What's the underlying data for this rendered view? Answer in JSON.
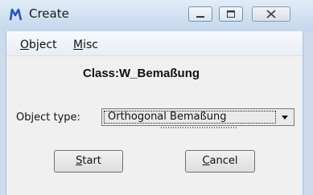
{
  "window": {
    "title": "Create",
    "icon": "mstn-logo-icon",
    "buttons": [
      "minimize-icon",
      "maximize-icon",
      "close-icon"
    ]
  },
  "menu": {
    "items": [
      {
        "label": "Object",
        "accel": "O",
        "rest": "bject"
      },
      {
        "label": "Misc",
        "accel": "M",
        "rest": "isc"
      }
    ]
  },
  "main": {
    "class_label": "Class:W_Bemaßung",
    "object_type_label": "Object type:",
    "object_type_value": "Orthogonal Bemaßung"
  },
  "buttons": {
    "start": {
      "label": "Start",
      "accel": "S",
      "rest": "tart"
    },
    "cancel": {
      "label": "Cancel",
      "accel": "C",
      "rest": "ancel"
    }
  },
  "colors": {
    "titlebar": "#cfdff0",
    "client": "#f0f0f0",
    "logo": "#2458b8"
  }
}
